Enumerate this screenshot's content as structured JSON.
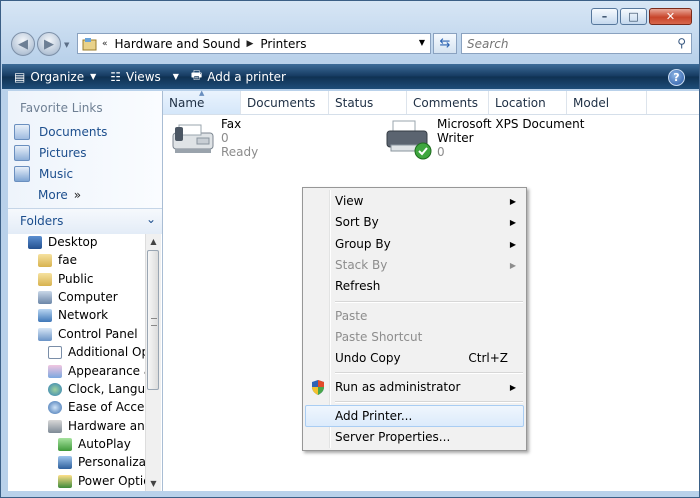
{
  "address": {
    "crumbs": [
      "Hardware and Sound",
      "Printers"
    ],
    "back_marker": "«"
  },
  "search": {
    "placeholder": "Search"
  },
  "toolbar": {
    "organize": "Organize",
    "views": "Views",
    "add_printer": "Add a printer"
  },
  "nav": {
    "favorite_title": "Favorite Links",
    "favorites": [
      "Documents",
      "Pictures",
      "Music"
    ],
    "more": "More",
    "more_glyph": "»",
    "folders_title": "Folders",
    "tree": [
      "Desktop",
      "fae",
      "Public",
      "Computer",
      "Network",
      "Control Panel",
      "Additional Opt",
      "Appearance ar",
      "Clock, Languag",
      "Ease of Access",
      "Hardware and",
      "AutoPlay",
      "Personalizati",
      "Power Optio"
    ]
  },
  "columns": [
    "Name",
    "Documents",
    "Status",
    "Comments",
    "Location",
    "Model"
  ],
  "printers": [
    {
      "name": "Fax",
      "documents": "0",
      "status": "Ready"
    },
    {
      "name_line1": "Microsoft XPS Document",
      "name_line2": "Writer",
      "documents": "0"
    }
  ],
  "context_menu": {
    "view": "View",
    "sort_by": "Sort By",
    "group_by": "Group By",
    "stack_by": "Stack By",
    "refresh": "Refresh",
    "paste": "Paste",
    "paste_shortcut": "Paste Shortcut",
    "undo_copy": "Undo Copy",
    "undo_copy_shortcut": "Ctrl+Z",
    "run_as_admin": "Run as administrator",
    "add_printer": "Add Printer...",
    "server_properties": "Server Properties..."
  },
  "colors": {
    "toolbar": "#1e4d79",
    "link": "#1c4e8d",
    "menu_bg": "#f1f1f1",
    "hover": "#dcebfc"
  }
}
